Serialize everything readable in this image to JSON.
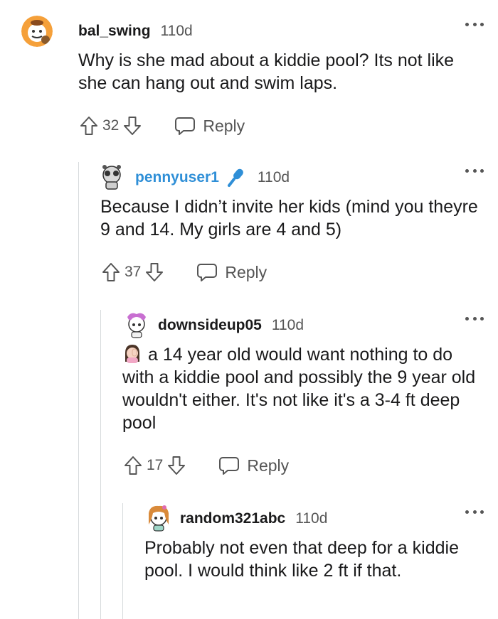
{
  "comments": [
    {
      "username": "bal_swing",
      "time": "110d",
      "text": "Why is she mad about a kiddie pool? Its not like she can hang out and swim laps.",
      "votes": "32",
      "reply_label": "Reply"
    },
    {
      "username": "pennyuser1",
      "time": "110d",
      "text": "Because I didn’t invite her kids (mind you theyre 9 and 14. My girls are 4 and 5)",
      "votes": "37",
      "reply_label": "Reply",
      "is_op": true,
      "op_color": "#2f8fd7"
    },
    {
      "username": "downsideup05",
      "time": "110d",
      "emoji": "woman-facepalming",
      "text": "a 14 year old would want nothing to do with a kiddie pool and possibly the 9 year old wouldn't either. It's not like it's a 3-4 ft deep pool",
      "votes": "17",
      "reply_label": "Reply"
    },
    {
      "username": "random321abc",
      "time": "110d",
      "text": "Probably not even that deep for a kiddie pool. I would think like 2 ft if that."
    }
  ]
}
